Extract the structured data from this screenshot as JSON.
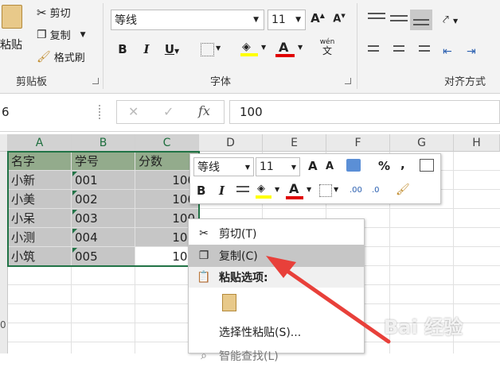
{
  "clipboard": {
    "cut": "剪切",
    "copy": "复制",
    "format_painter": "格式刷",
    "paste": "粘贴",
    "group": "剪贴板"
  },
  "font": {
    "name": "等线",
    "size": "11",
    "group": "字体",
    "grow_glyph": "A",
    "bold": "B",
    "italic": "I",
    "underline": "U",
    "font_color_glyph": "A",
    "phonetic_top": "wén",
    "phonetic_bottom": "文"
  },
  "alignment": {
    "group": "对齐方式"
  },
  "formula_bar": {
    "name_box": "6",
    "cancel": "✕",
    "enter": "✓",
    "fx": "fx",
    "value": "100"
  },
  "columns": [
    "A",
    "B",
    "C",
    "D",
    "E",
    "F",
    "G",
    "H"
  ],
  "row_number_visible": "0",
  "table": {
    "headers": [
      "名字",
      "学号",
      "分数"
    ],
    "rows": [
      [
        "小新",
        "001",
        "100"
      ],
      [
        "小美",
        "002",
        "100"
      ],
      [
        "小呆",
        "003",
        "100"
      ],
      [
        "小测",
        "004",
        "100"
      ],
      [
        "小筑",
        "005",
        "100"
      ]
    ]
  },
  "mini_toolbar": {
    "font": "等线",
    "size": "11",
    "percent": "%",
    "comma": ",",
    "bold": "B",
    "italic": "I",
    "font_color_glyph": "A",
    "inc_decimal": ".00",
    "dec_decimal": ".0"
  },
  "context_menu": {
    "cut": "剪切(T)",
    "copy": "复制(C)",
    "paste_options": "粘贴选项:",
    "paste_special": "选择性粘贴(S)...",
    "smart_lookup": "智能查找(L)"
  },
  "colors": {
    "accent_green": "#217346",
    "arrow_red": "#e8403a",
    "font_red": "#e00000"
  },
  "watermark": "Bai 经验"
}
